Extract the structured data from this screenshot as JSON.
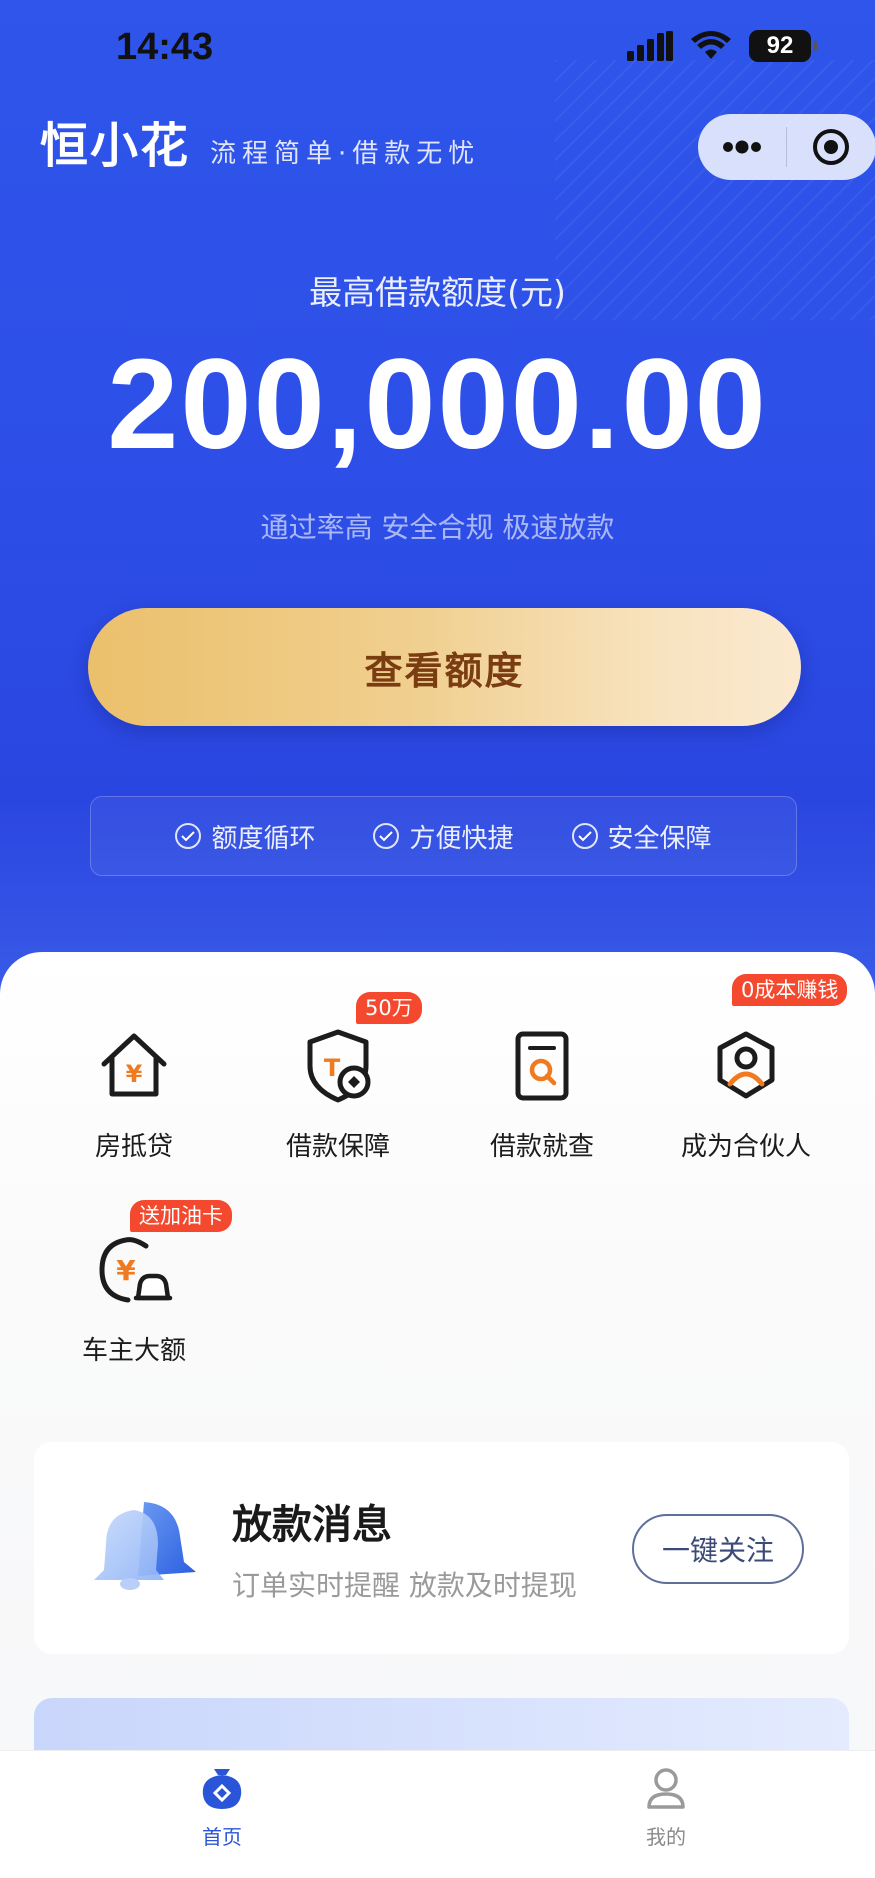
{
  "status_bar": {
    "time": "14:43",
    "battery": "92"
  },
  "header": {
    "logo": "恒小花",
    "slogan": "流程简单·借款无忧"
  },
  "limit": {
    "title": "最高借款额度(元)",
    "amount": "200,000.00",
    "subtitle": "通过率高 安全合规 极速放款",
    "cta_label": "查看额度"
  },
  "features": [
    {
      "label": "额度循环"
    },
    {
      "label": "方便快捷"
    },
    {
      "label": "安全保障"
    }
  ],
  "services": [
    {
      "label": "房抵贷",
      "icon": "house-yen-icon",
      "tag": ""
    },
    {
      "label": "借款保障",
      "icon": "shield-icon",
      "tag": "50万"
    },
    {
      "label": "借款就查",
      "icon": "search-document-icon",
      "tag": ""
    },
    {
      "label": "成为合伙人",
      "icon": "partner-icon",
      "tag": "0成本赚钱"
    },
    {
      "label": "车主大额",
      "icon": "car-yen-icon",
      "tag": "送加油卡"
    }
  ],
  "notify": {
    "title": "放款消息",
    "subtitle": "订单实时提醒 放款及时提现",
    "button": "一键关注"
  },
  "tabbar": [
    {
      "label": "首页",
      "active": true
    },
    {
      "label": "我的",
      "active": false
    }
  ],
  "colors": {
    "brand_blue": "#2d4fe8",
    "cta_gold": "#ebc06c",
    "cta_text": "#7a3d12",
    "tag_red": "#f4492e",
    "icon_orange": "#f07a1f",
    "tab_active": "#2a55d8"
  }
}
